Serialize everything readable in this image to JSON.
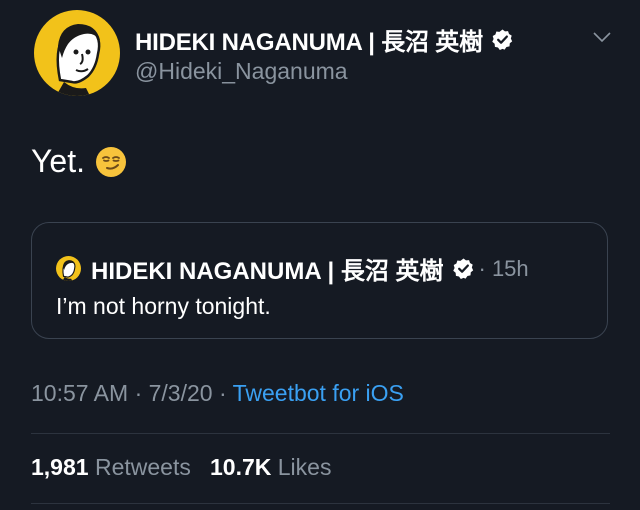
{
  "author": {
    "display_name": "HIDEKI NAGANUMA | 長沼 英樹",
    "handle": "@Hideki_Naganuma",
    "verified": true,
    "avatar_icon": "cartoon-avatar"
  },
  "tweet": {
    "text": "Yet.",
    "emoji_icon": "smirking-face-emoji"
  },
  "quote": {
    "display_name": "HIDEKI NAGANUMA | 長沼 英樹",
    "time": "· 15h",
    "text": "I’m not horny tonight."
  },
  "meta": {
    "timestamp": "10:57 AM · 7/3/20 · ",
    "client": "Tweetbot for iOS"
  },
  "stats": {
    "retweets_count": "1,981",
    "retweets_label": "Retweets",
    "likes_count": "10.7K",
    "likes_label": "Likes"
  },
  "colors": {
    "background": "#151a23",
    "link": "#3aa0f2",
    "muted": "#8a949f",
    "avatar_bg": "#f2c21a"
  }
}
